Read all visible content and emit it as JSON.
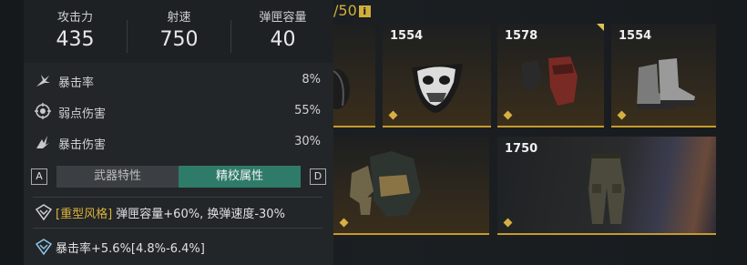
{
  "top_fragment": {
    "text": "/50",
    "info_icon": "i"
  },
  "weapon_stats": [
    {
      "label": "攻击力",
      "value": "435"
    },
    {
      "label": "射速",
      "value": "750"
    },
    {
      "label": "弹匣容量",
      "value": "40"
    }
  ],
  "attributes": [
    {
      "icon": "crit-rate-icon",
      "name": "暴击率",
      "value": "8%"
    },
    {
      "icon": "weakspot-icon",
      "name": "弱点伤害",
      "value": "55%"
    },
    {
      "icon": "crit-damage-icon",
      "name": "暴击伤害",
      "value": "30%"
    }
  ],
  "tabs": {
    "left_key": "A",
    "right_key": "D",
    "tab_weapon": "武器特性",
    "tab_refine": "精校属性",
    "active": "精校属性"
  },
  "affixes": [
    {
      "tag": "[重型风格]",
      "text": " 弹匣容量+60%, 换弹速度-30%"
    },
    {
      "tag": "",
      "text": "暴击率+5.6%[4.8%-6.4%]"
    }
  ],
  "items": [
    {
      "id": "helmet",
      "level": "",
      "name": "helmet-item"
    },
    {
      "id": "mask",
      "level": "1554",
      "name": "mask-item"
    },
    {
      "id": "gloves",
      "level": "1578",
      "name": "gloves-item",
      "new": true
    },
    {
      "id": "boots",
      "level": "1554",
      "name": "boots-item"
    },
    {
      "id": "armor",
      "level": "",
      "name": "armor-item"
    },
    {
      "id": "pants",
      "level": "1750",
      "name": "pants-item"
    }
  ],
  "colors": {
    "accent_gold": "#c79a2c",
    "active_tab": "#2f7b6a",
    "panel": "#232628"
  }
}
